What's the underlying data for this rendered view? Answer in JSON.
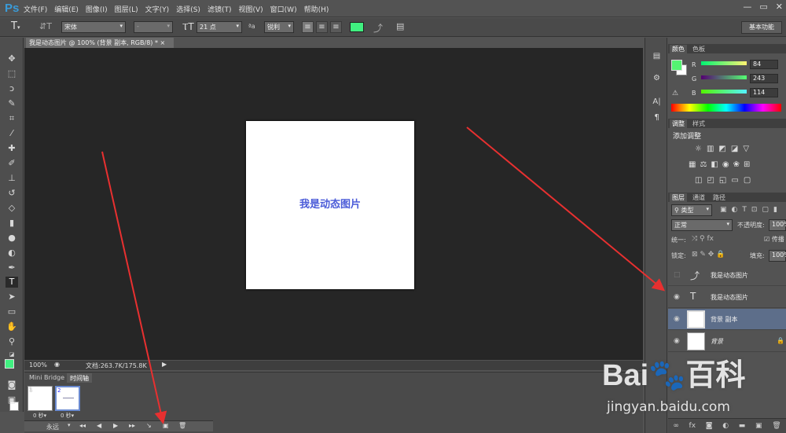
{
  "app": {
    "logo": "Ps"
  },
  "menu": [
    "文件(F)",
    "编辑(E)",
    "图像(I)",
    "图层(L)",
    "文字(Y)",
    "选择(S)",
    "滤镜(T)",
    "视图(V)",
    "窗口(W)",
    "帮助(H)"
  ],
  "window_controls": {
    "minimize": "—",
    "restore": "▭",
    "close": "✕"
  },
  "options": {
    "font_family": "宋体",
    "font_style": "-",
    "font_size": "21 点",
    "aa_label": "ªa",
    "aa_mode": "锐利",
    "text_color": "#40f080",
    "workspace": "基本功能"
  },
  "document": {
    "tab_title": "我是动态图片 @ 100% (背景 副本, RGB/8) *",
    "canvas_text": "我是动态图片",
    "zoom": "100%",
    "doc_info": "文档:263.7K/175.8K"
  },
  "timeline": {
    "tabs": [
      "Mini Bridge",
      "时间轴"
    ],
    "frames": [
      {
        "num": "1",
        "delay": "0 秒▾"
      },
      {
        "num": "2",
        "delay": "0 秒▾"
      }
    ],
    "loop": "永远"
  },
  "color_panel": {
    "tabs": [
      "颜色",
      "色板"
    ],
    "r": "84",
    "g": "243",
    "b": "114",
    "r_label": "R",
    "g_label": "G",
    "b_label": "B",
    "fg": "#54f372"
  },
  "adjust_panel": {
    "tabs": [
      "调整",
      "样式"
    ],
    "title": "添加调整"
  },
  "layers_panel": {
    "tabs": [
      "图层",
      "通道",
      "路径"
    ],
    "filter_kind": "类型",
    "blend_mode": "正常",
    "opacity_label": "不透明度:",
    "opacity": "100%",
    "unify_label": "统一:",
    "propagate_label": "传播",
    "lock_label": "锁定:",
    "fill_label": "填充:",
    "fill": "100%",
    "layers": [
      {
        "name": "我是动态图片",
        "kind": "warp-text",
        "visible": false
      },
      {
        "name": "我是动态图片",
        "kind": "text",
        "visible": true
      },
      {
        "name": "背景 副本",
        "kind": "pixel",
        "visible": true,
        "selected": true
      },
      {
        "name": "背景",
        "kind": "pixel",
        "visible": true,
        "locked": true
      }
    ]
  },
  "watermark": {
    "brand": "Bai",
    "brand2": "百科",
    "sub": "jingyan.baidu.com"
  },
  "annotation_color": "#e83030"
}
